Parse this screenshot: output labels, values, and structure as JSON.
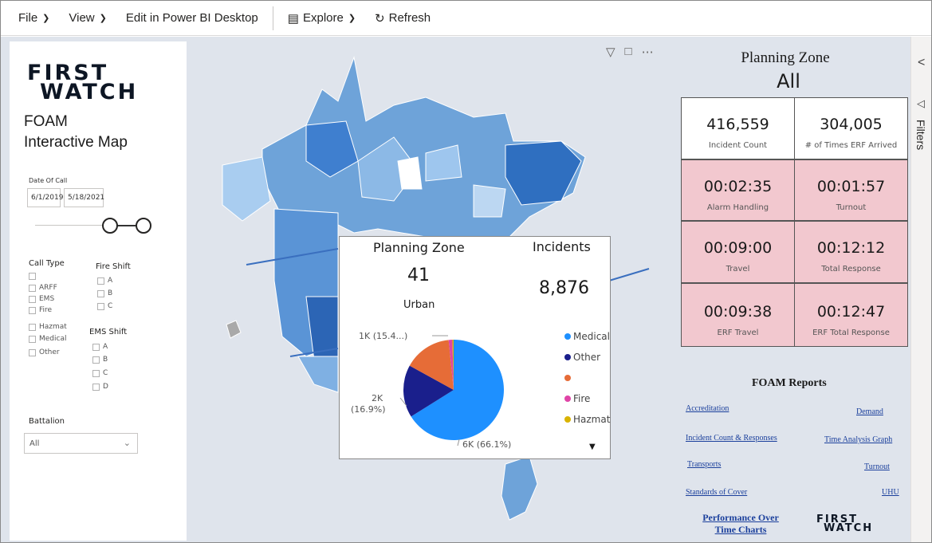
{
  "toolbar": {
    "file": "File",
    "view": "View",
    "edit": "Edit in Power BI Desktop",
    "explore": "Explore",
    "refresh": "Refresh"
  },
  "filters_pane": {
    "label": "Filters"
  },
  "logo": {
    "line1": "FIRST",
    "line2": "WATCH"
  },
  "left": {
    "title_line1": "FOAM",
    "title_line2": "Interactive Map",
    "date_label": "Date Of Call",
    "date_start": "6/1/2019",
    "date_end": "5/18/2021",
    "call_type_label": "Call Type",
    "call_types": [
      "",
      "ARFF",
      "EMS",
      "Fire",
      "Hazmat",
      "Medical",
      "Other"
    ],
    "fire_shift_label": "Fire Shift",
    "fire_shifts": [
      "A",
      "B",
      "C"
    ],
    "ems_shift_label": "EMS Shift",
    "ems_shifts": [
      "A",
      "B",
      "C",
      "D"
    ],
    "battalion_label": "Battalion",
    "battalion_value": "All"
  },
  "tooltip": {
    "zone_header": "Planning Zone",
    "incidents_header": "Incidents",
    "zone_value": "41",
    "incidents_value": "8,876",
    "zone_name": "Urban",
    "pie_labels": {
      "a": "1K (15.4...)",
      "b_count": "2K",
      "b_pct": "(16.9%)",
      "c": "6K (66.1%)"
    },
    "legend": [
      {
        "label": "Medical",
        "color": "#1e90ff"
      },
      {
        "label": "Other",
        "color": "#1a1f8c"
      },
      {
        "label": "",
        "color": "#e66c37"
      },
      {
        "label": "Fire",
        "color": "#e044a7"
      },
      {
        "label": "Hazmat",
        "color": "#d9b300"
      }
    ],
    "more_icon": "caret-down-icon"
  },
  "chart_data": {
    "type": "pie",
    "categories": [
      "Medical",
      "Other",
      "(blank)",
      "Fire",
      "Hazmat"
    ],
    "values": [
      66.1,
      16.9,
      15.4,
      1.2,
      0.4
    ],
    "colors": [
      "#1e90ff",
      "#1a1f8c",
      "#e66c37",
      "#e044a7",
      "#d9b300"
    ]
  },
  "kpi": {
    "zone_title": "Planning Zone",
    "zone_value": "All",
    "incident_count": "416,559",
    "incident_count_label": "Incident Count",
    "erf_arrived": "304,005",
    "erf_arrived_label": "# of Times ERF Arrived",
    "alarm_handling": "00:02:35",
    "alarm_handling_label": "Alarm Handling",
    "turnout": "00:01:57",
    "turnout_label": "Turnout",
    "travel": "00:09:00",
    "travel_label": "Travel",
    "total_response": "00:12:12",
    "total_response_label": "Total Response",
    "erf_travel": "00:09:38",
    "erf_travel_label": "ERF Travel",
    "erf_total_response": "00:12:47",
    "erf_total_response_label": "ERF Total Response"
  },
  "reports": {
    "title": "FOAM Reports",
    "accreditation": "Accreditation",
    "demand": "Demand",
    "incident_count_responses": "Incident Count & Responses",
    "time_analysis_graph": "Time Analysis Graph",
    "transports": "Transports",
    "turnout": "Turnout",
    "standards_of_cover": "Standards of Cover",
    "uhu": "UHU",
    "perf_line1": "Performance Over",
    "perf_line2": "Time Charts"
  }
}
